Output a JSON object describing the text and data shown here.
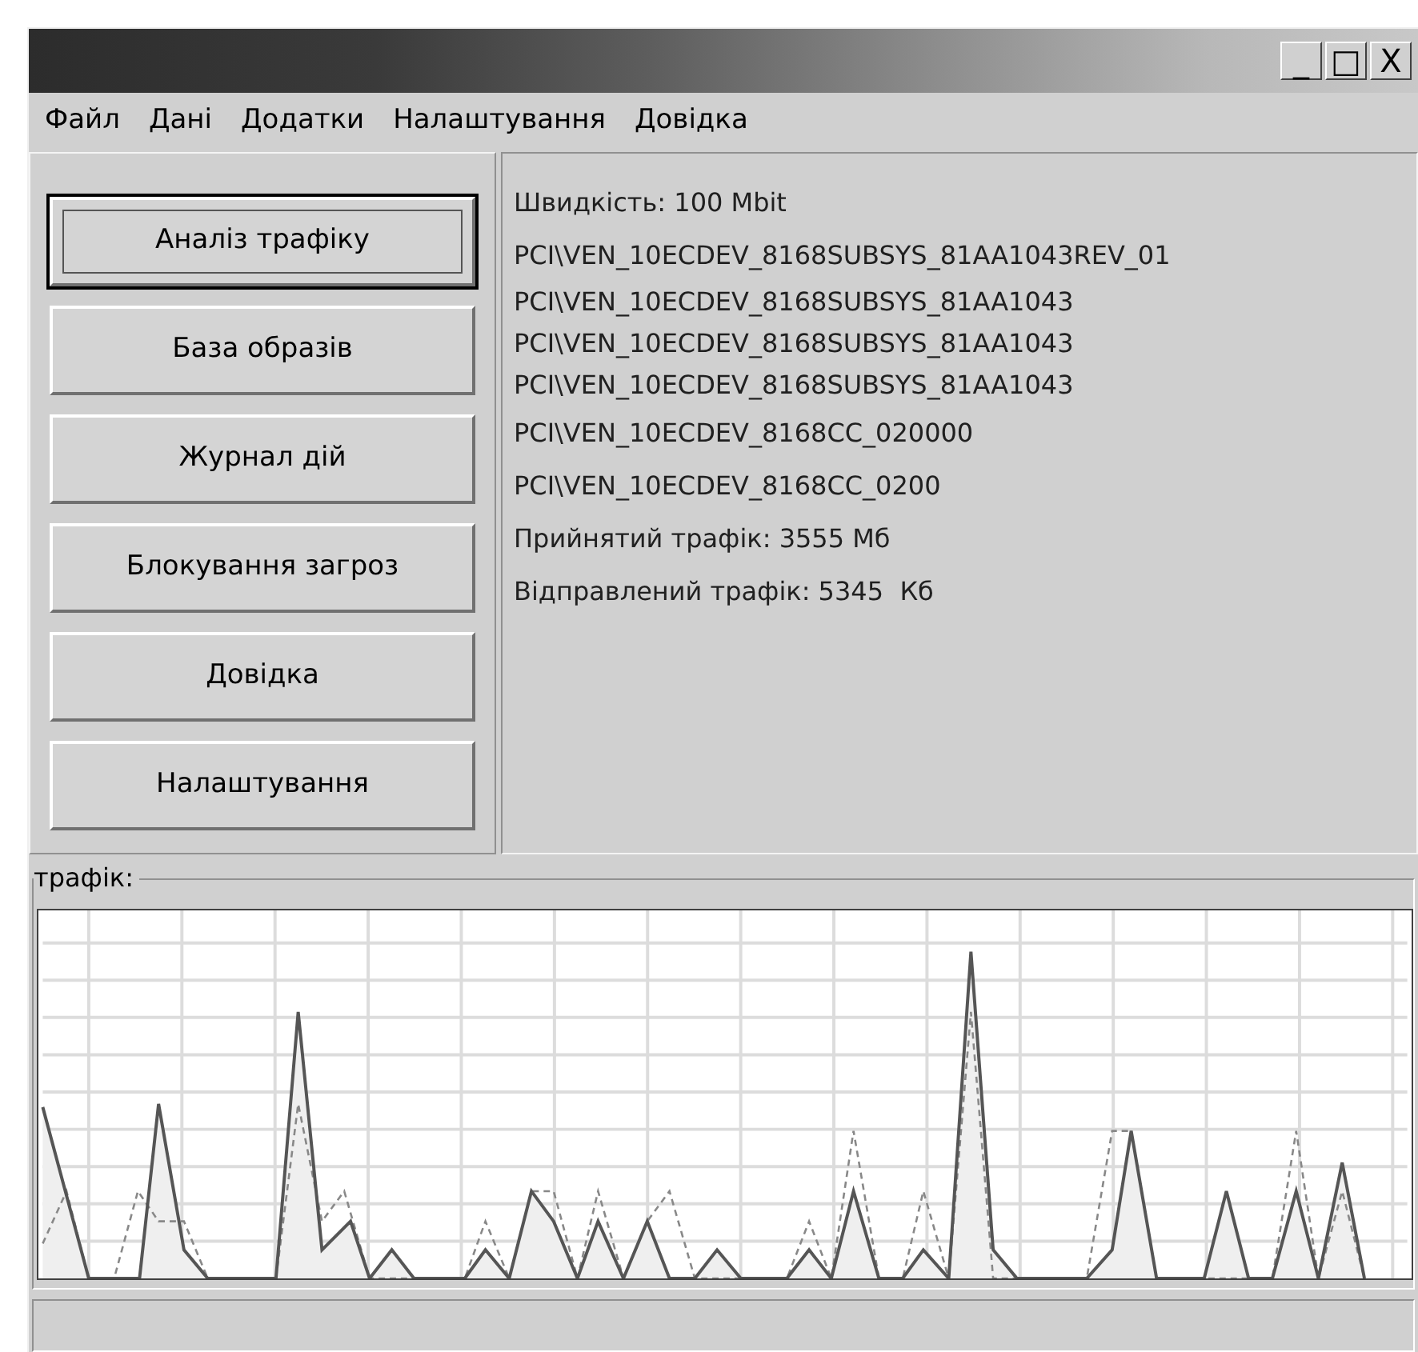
{
  "window": {
    "controls": [
      "_",
      "□",
      "X"
    ]
  },
  "menu": [
    "Файл",
    "Дані",
    "Додатки",
    "Налаштування",
    "Довідка"
  ],
  "nav_buttons": [
    {
      "label": "Аналіз трафіку",
      "selected": true
    },
    {
      "label": "База образів",
      "selected": false
    },
    {
      "label": "Журнал дій",
      "selected": false
    },
    {
      "label": "Блокування загроз",
      "selected": false
    },
    {
      "label": "Довідка",
      "selected": false
    },
    {
      "label": "Налаштування",
      "selected": false
    }
  ],
  "info_lines": [
    "Швидкість: 100 Mbit",
    "PCI\\VEN_10ECDEV_8168SUBSYS_81AA1043REV_01",
    "PCI\\VEN_10ECDEV_8168SUBSYS_81AA1043",
    "PCI\\VEN_10ECDEV_8168SUBSYS_81AA1043",
    "PCI\\VEN_10ECDEV_8168SUBSYS_81AA1043",
    "PCI\\VEN_10ECDEV_8168CC_020000",
    "PCI\\VEN_10ECDEV_8168CC_0200",
    "Прийнятий трафік: 3555 Мб",
    "Відправлений трафік: 5345  Кб"
  ],
  "traffic": {
    "title": "трафік:"
  }
}
